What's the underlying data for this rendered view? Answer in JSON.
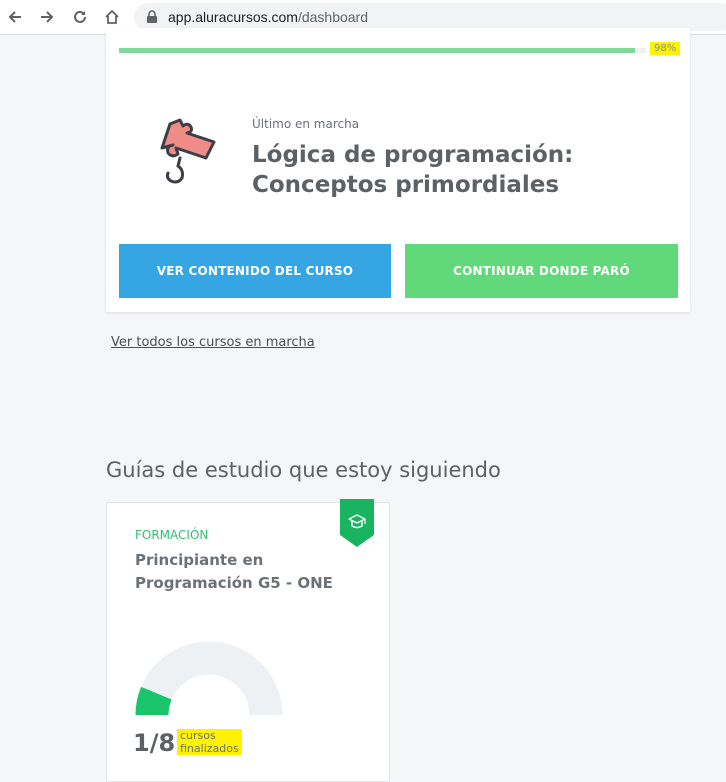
{
  "browser": {
    "url_domain": "app.aluracursos.com",
    "url_path": "/dashboard"
  },
  "course": {
    "progress": 98,
    "progress_label": "98%",
    "last_label": "Último en marcha",
    "title_line1": "Lógica de programación:",
    "title_line2": "Conceptos primordiales",
    "btn_contents": "VER CONTENIDO DEL CURSO",
    "btn_continue": "CONTINUAR DONDE PARÓ"
  },
  "links": {
    "all_courses": "Ver todos los cursos en marcha"
  },
  "guides": {
    "section_title": "Guías de estudio que estoy siguiendo",
    "card": {
      "kind": "FORMACIÓN",
      "title_line1": "Principiante en",
      "title_line2": "Programación G5 - ONE",
      "count": "1/8",
      "count_label_line1": "cursos",
      "count_label_line2": "finalizados",
      "completed": 1,
      "total": 8
    }
  },
  "colors": {
    "blue": "#36a5e3",
    "green": "#61d97a",
    "progress": "#7ed99a",
    "accent_green": "#2fbf71",
    "highlight": "#fff200"
  }
}
